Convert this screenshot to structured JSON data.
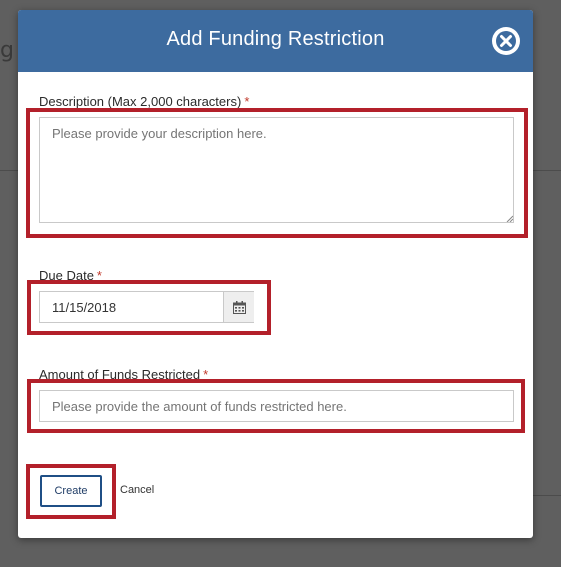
{
  "modal": {
    "title": "Add Funding Restriction",
    "description": {
      "label": "Description (Max 2,000 characters)",
      "required_mark": "*",
      "placeholder": "Please provide your description here.",
      "value": ""
    },
    "due_date": {
      "label": "Due Date",
      "required_mark": "*",
      "value": "11/15/2018"
    },
    "amount": {
      "label": "Amount of Funds Restricted",
      "required_mark": "*",
      "placeholder": "Please provide the amount of funds restricted here.",
      "value": ""
    },
    "create_label": "Create",
    "cancel_label": "Cancel"
  },
  "colors": {
    "header": "#3d6b9f",
    "highlight": "#b3202a",
    "required": "#c0392b",
    "button_border": "#1f4f86"
  },
  "icons": [
    "close-icon",
    "calendar-icon",
    "resize-grip-icon"
  ]
}
